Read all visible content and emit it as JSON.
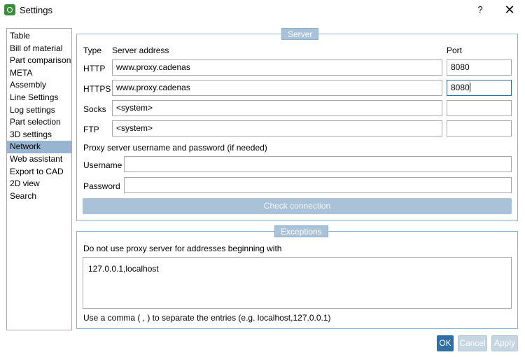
{
  "window": {
    "title": "Settings",
    "help_label": "?",
    "close_label": "✕"
  },
  "nav": {
    "items": [
      {
        "label": "Table"
      },
      {
        "label": "Bill of material"
      },
      {
        "label": "Part comparison"
      },
      {
        "label": "META"
      },
      {
        "label": "Assembly"
      },
      {
        "label": "Line Settings"
      },
      {
        "label": "Log settings"
      },
      {
        "label": "Part selection"
      },
      {
        "label": "3D settings"
      },
      {
        "label": "Network"
      },
      {
        "label": "Web assistant"
      },
      {
        "label": "Export to CAD"
      },
      {
        "label": "2D view"
      },
      {
        "label": "Search"
      }
    ],
    "selected": "Network"
  },
  "server": {
    "title": "Server",
    "col_type": "Type",
    "col_address": "Server address",
    "col_port": "Port",
    "rows": [
      {
        "type": "HTTP",
        "address": "www.proxy.cadenas",
        "port": "8080"
      },
      {
        "type": "HTTPS",
        "address": "www.proxy.cadenas",
        "port": "8080"
      },
      {
        "type": "Socks",
        "address": "<system>",
        "port": ""
      },
      {
        "type": "FTP",
        "address": "<system>",
        "port": ""
      }
    ],
    "credentials_note": "Proxy server username and password (if needed)",
    "username_label": "Username",
    "username_value": "",
    "password_label": "Password",
    "password_value": "",
    "check_button": "Check connection"
  },
  "exceptions": {
    "title": "Exceptions",
    "description": "Do not use proxy server for addresses beginning with",
    "value": "127.0.0.1,localhost",
    "hint": "Use a comma ( , ) to separate the entries (e.g. localhost,127.0.0.1)"
  },
  "buttons": {
    "ok": "OK",
    "cancel": "Cancel",
    "apply": "Apply"
  },
  "colors": {
    "accent": "#2e6fa6",
    "selection": "#99b4d1",
    "group_header": "#a9c2d8",
    "app_icon": "#3d8b3d"
  }
}
